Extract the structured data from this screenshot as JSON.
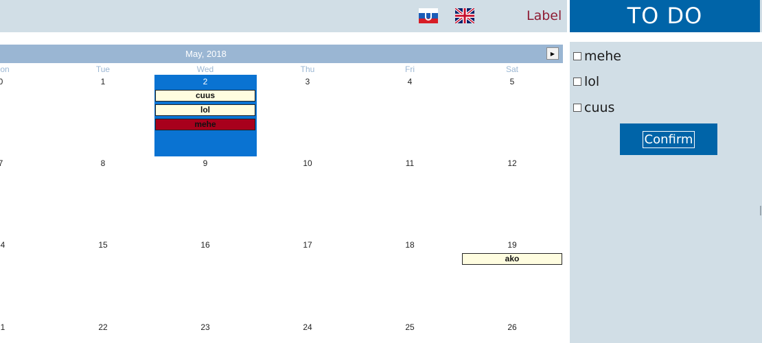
{
  "top_bar": {
    "label": "Label",
    "languages": [
      {
        "name": "russian-flag",
        "colors": [
          "#ffffff",
          "#1c5db8",
          "#d71d26"
        ]
      },
      {
        "name": "uk-flag",
        "colors": [
          "#012169",
          "#ffffff",
          "#c8102e"
        ]
      }
    ]
  },
  "calendar": {
    "title": "May, 2018",
    "next_icon": "triangle-right-icon",
    "weekdays": [
      "on",
      "Tue",
      "Wed",
      "Thu",
      "Fri",
      "Sat"
    ],
    "weeks": [
      [
        "0",
        "1",
        "2",
        "3",
        "4",
        "5"
      ],
      [
        "7",
        "8",
        "9",
        "10",
        "11",
        "12"
      ],
      [
        "4",
        "15",
        "16",
        "17",
        "18",
        "19"
      ],
      [
        "1",
        "22",
        "23",
        "24",
        "25",
        "26"
      ]
    ],
    "selected_day": "2",
    "events": {
      "day2": [
        "cuus",
        "lol",
        "mehe"
      ],
      "day19": [
        "ako"
      ]
    }
  },
  "todo": {
    "title": "TO DO",
    "items": [
      "mehe",
      "lol",
      "cuus"
    ],
    "confirm_label": "Confirm"
  },
  "colors": {
    "accent": "#0064a8",
    "selected_day": "#0a73d2",
    "panel_bg": "#d1dee6",
    "header_bg": "#9ab6d3",
    "label_color": "#8e1b32",
    "event_red": "#a8001c",
    "event_yellow": "#fffde0"
  }
}
